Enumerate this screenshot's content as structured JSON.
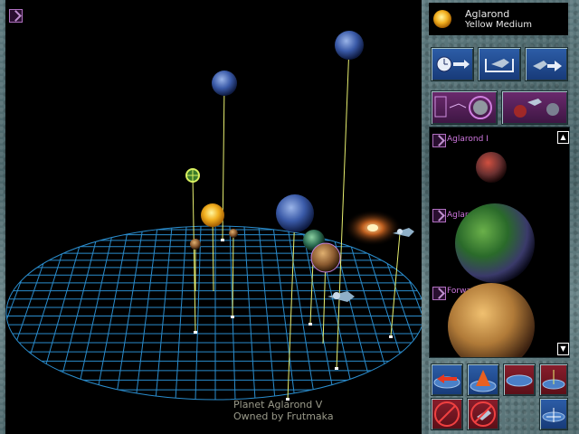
{
  "star": {
    "name": "Aglarond",
    "type": "Yellow Medium"
  },
  "view": {
    "caption_line1": "Planet Aglarond V",
    "caption_line2": "Owned by Frutmaka"
  },
  "planet_list": {
    "items": [
      {
        "label": "Aglarond I"
      },
      {
        "label": "Aglarond III"
      },
      {
        "label": "Forward Station"
      }
    ],
    "scroll_up": "▲",
    "scroll_down": "▼"
  },
  "colors": {
    "grid": "#2a8ccc",
    "stalk": "#e8f070",
    "frame": "#5f7b80",
    "list_label": "#d078e0"
  },
  "icons": [
    "clock-arrow-icon",
    "ship-box-icon",
    "fleet-arrow-icon",
    "star-route-icon",
    "fleet-planets-icon",
    "rotate-left-icon",
    "tilt-up-icon",
    "grid-view-icon",
    "grid-axis-icon",
    "no-route-icon",
    "no-fleet-icon",
    "center-grid-icon"
  ]
}
